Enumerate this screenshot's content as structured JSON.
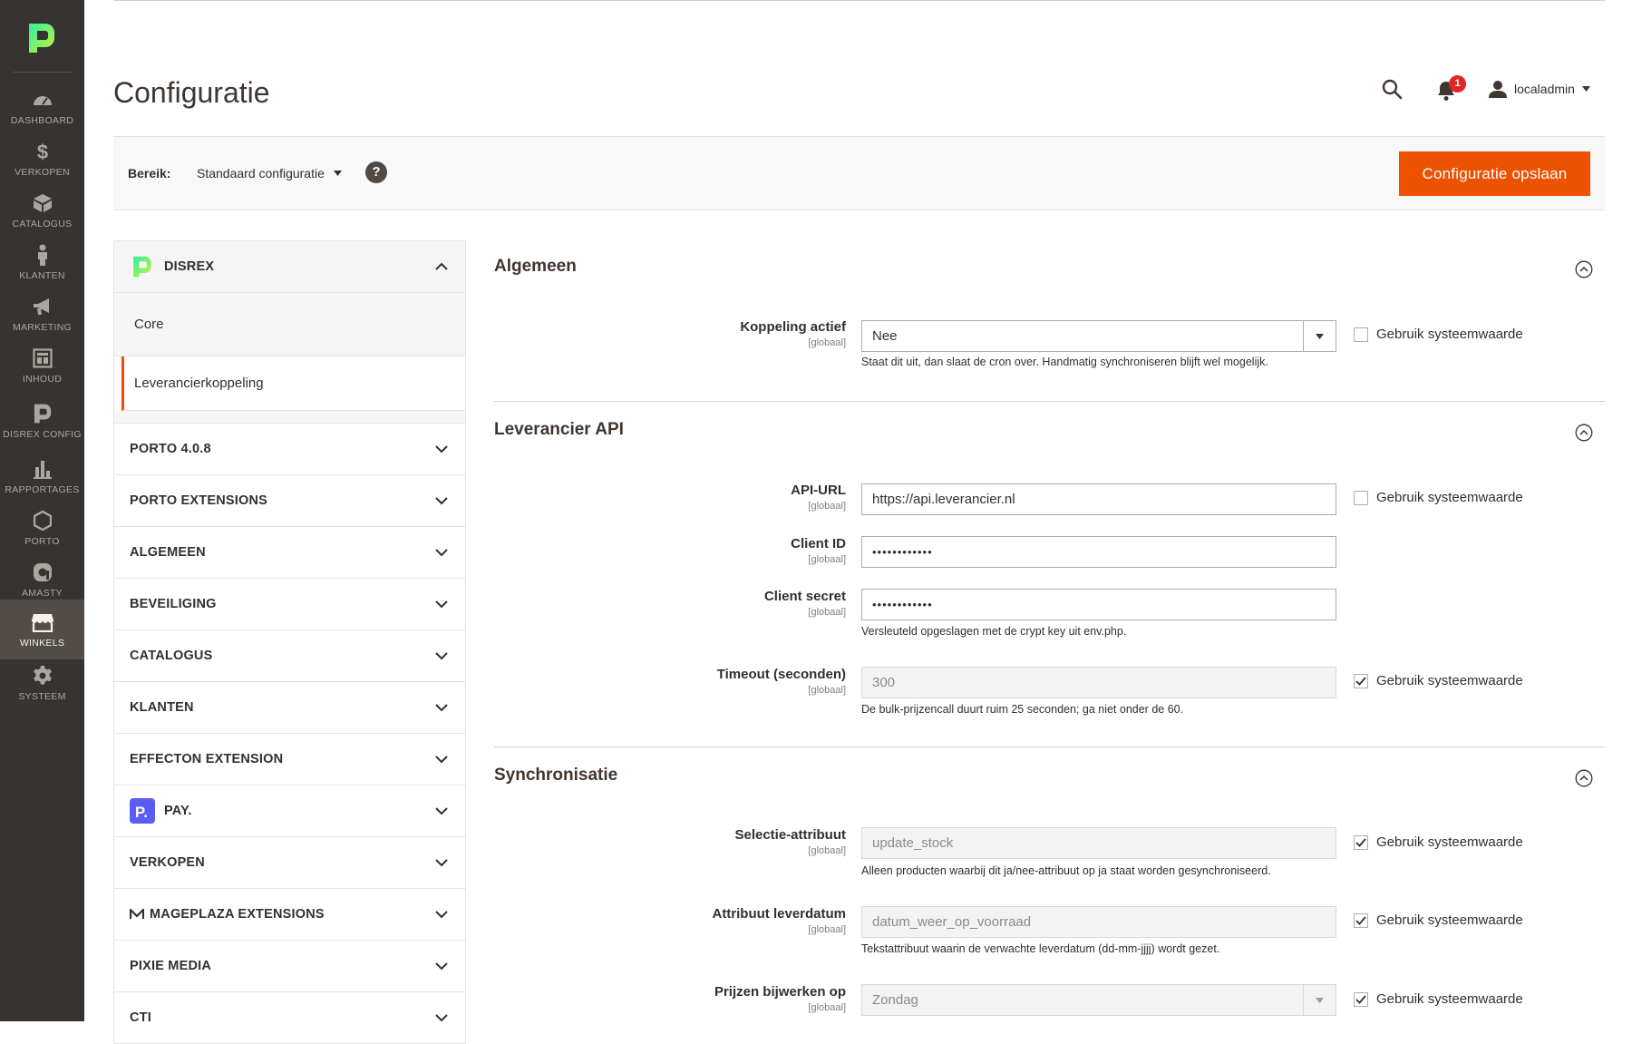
{
  "nav": {
    "items": [
      {
        "label": "Dashboard",
        "icon": "dashboard-icon"
      },
      {
        "label": "Verkopen",
        "icon": "dollar-icon"
      },
      {
        "label": "Catalogus",
        "icon": "box-icon"
      },
      {
        "label": "Klanten",
        "icon": "person-icon"
      },
      {
        "label": "Marketing",
        "icon": "megaphone-icon"
      },
      {
        "label": "Inhoud",
        "icon": "layout-icon"
      },
      {
        "label": "Disrex config",
        "icon": "disrex-icon"
      },
      {
        "label": "Rapportages",
        "icon": "bar-chart-icon"
      },
      {
        "label": "Porto",
        "icon": "hexagon-icon"
      },
      {
        "label": "Amasty",
        "icon": "amasty-icon"
      },
      {
        "label": "Winkels",
        "icon": "store-icon",
        "active": true
      },
      {
        "label": "Systeem",
        "icon": "gear-icon"
      }
    ]
  },
  "header": {
    "title": "Configuratie",
    "notification_count": "1",
    "user": "localadmin"
  },
  "scope": {
    "label": "Bereik:",
    "value": "Standaard configuratie",
    "help": "?",
    "save_label": "Configuratie opslaan"
  },
  "tabs": {
    "disrex": {
      "label": "DISREX",
      "sub": [
        "Core",
        "Leverancierkoppeling"
      ],
      "active_sub": "Leverancierkoppeling"
    },
    "groups": [
      "PORTO 4.0.8",
      "PORTO EXTENSIONS",
      "ALGEMEEN",
      "BEVEILIGING",
      "CATALOGUS",
      "KLANTEN",
      "EFFECTON EXTENSION",
      "PAY.",
      "VERKOPEN",
      "MAGEPLAZA EXTENSIONS",
      "PIXIE MEDIA",
      "CTI"
    ]
  },
  "sections": {
    "algemeen": {
      "title": "Algemeen",
      "koppeling": {
        "label": "Koppeling actief",
        "scope": "[globaal]",
        "value": "Nee",
        "note": "Staat dit uit, dan slaat de cron over. Handmatig synchroniseren blijft wel mogelijk.",
        "use_system": "Gebruik systeemwaarde",
        "use_system_checked": false
      }
    },
    "api": {
      "title": "Leverancier API",
      "url": {
        "label": "API-URL",
        "scope": "[globaal]",
        "value": "https://api.leverancier.nl",
        "use_system": "Gebruik systeemwaarde",
        "use_system_checked": false
      },
      "client_id": {
        "label": "Client ID",
        "scope": "[globaal]",
        "value": "••••••••••••"
      },
      "client_secret": {
        "label": "Client secret",
        "scope": "[globaal]",
        "value": "••••••••••••",
        "note": "Versleuteld opgeslagen met de crypt key uit env.php."
      },
      "timeout": {
        "label": "Timeout (seconden)",
        "scope": "[globaal]",
        "value": "300",
        "note": "De bulk-prijzencall duurt ruim 25 seconden; ga niet onder de 60.",
        "use_system": "Gebruik systeemwaarde",
        "use_system_checked": true
      }
    },
    "sync": {
      "title": "Synchronisatie",
      "selectie": {
        "label": "Selectie-attribuut",
        "scope": "[globaal]",
        "value": "update_stock",
        "note": "Alleen producten waarbij dit ja/nee-attribuut op ja staat worden gesynchroniseerd.",
        "use_system": "Gebruik systeemwaarde",
        "use_system_checked": true
      },
      "leverdatum": {
        "label": "Attribuut leverdatum",
        "scope": "[globaal]",
        "value": "datum_weer_op_voorraad",
        "note": "Tekstattribuut waarin de verwachte leverdatum (dd-mm-jjjj) wordt gezet.",
        "use_system": "Gebruik systeemwaarde",
        "use_system_checked": true
      },
      "prijzen": {
        "label": "Prijzen bijwerken op",
        "scope": "[globaal]",
        "value": "Zondag",
        "use_system": "Gebruik systeemwaarde",
        "use_system_checked": true
      }
    }
  },
  "colors": {
    "accent": "#eb5202",
    "nav_bg": "#373330",
    "brand_green": "#2ee87a",
    "badge": "#e22626",
    "pay_brand": "#5a5cf6"
  }
}
